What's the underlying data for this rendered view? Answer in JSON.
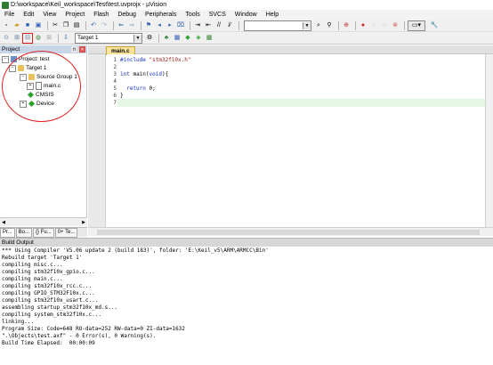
{
  "window": {
    "title": "D:\\workspace\\Keil_workspace\\Test\\test.uvprojx - µVision"
  },
  "menu": [
    "File",
    "Edit",
    "View",
    "Project",
    "Flash",
    "Debug",
    "Peripherals",
    "Tools",
    "SVCS",
    "Window",
    "Help"
  ],
  "toolbar": {
    "target": "Target 1"
  },
  "project": {
    "header": "Project",
    "tree": {
      "root": "Project: test",
      "target": "Target 1",
      "group": "Source Group 1",
      "file": "main.c",
      "cmsis": "CMSIS",
      "device": "Device"
    },
    "tabs": [
      "Pr...",
      "Bo...",
      "{} Fu...",
      "0+ Te..."
    ]
  },
  "editor": {
    "tab": "main.c",
    "lines": [
      {
        "n": "1",
        "parts": [
          {
            "t": "#include ",
            "c": "kw"
          },
          {
            "t": "\"stm32f10x.h\"",
            "c": "str"
          }
        ]
      },
      {
        "n": "2",
        "parts": []
      },
      {
        "n": "3",
        "parts": [
          {
            "t": "int ",
            "c": "kw"
          },
          {
            "t": "main(",
            "c": ""
          },
          {
            "t": "void",
            "c": "kw"
          },
          {
            "t": "){",
            "c": ""
          }
        ]
      },
      {
        "n": "4",
        "parts": []
      },
      {
        "n": "5",
        "parts": [
          {
            "t": "  return ",
            "c": "kw"
          },
          {
            "t": "0;",
            "c": ""
          }
        ]
      },
      {
        "n": "6",
        "parts": [
          {
            "t": "}",
            "c": ""
          }
        ]
      },
      {
        "n": "7",
        "parts": []
      }
    ]
  },
  "build": {
    "header": "Build Output",
    "lines": [
      "*** Using Compiler 'V5.06 update 2 (build 183)', folder: 'E:\\Keil_v5\\ARM\\ARMCC\\Bin'",
      "Rebuild target 'Target 1'",
      "compiling misc.c...",
      "compiling stm32f10x_gpio.c...",
      "compiling main.c...",
      "compiling stm32f10x_rcc.c...",
      "compiling GPIO_STM32F10x.c...",
      "compiling stm32f10x_usart.c...",
      "assembling startup_stm32f10x_md.s...",
      "compiling system_stm32f10x.c...",
      "linking...",
      "Program Size: Code=648 RO-data=252 RW-data=0 ZI-data=1632",
      "\".\\Objects\\test.axf\" - 0 Error(s), 0 Warning(s).",
      "Build Time Elapsed:  00:00:09"
    ]
  },
  "colors": {
    "highlight_circle": "#e02020",
    "current_line": "#e4f6e4",
    "tab": "#fbe39a"
  }
}
